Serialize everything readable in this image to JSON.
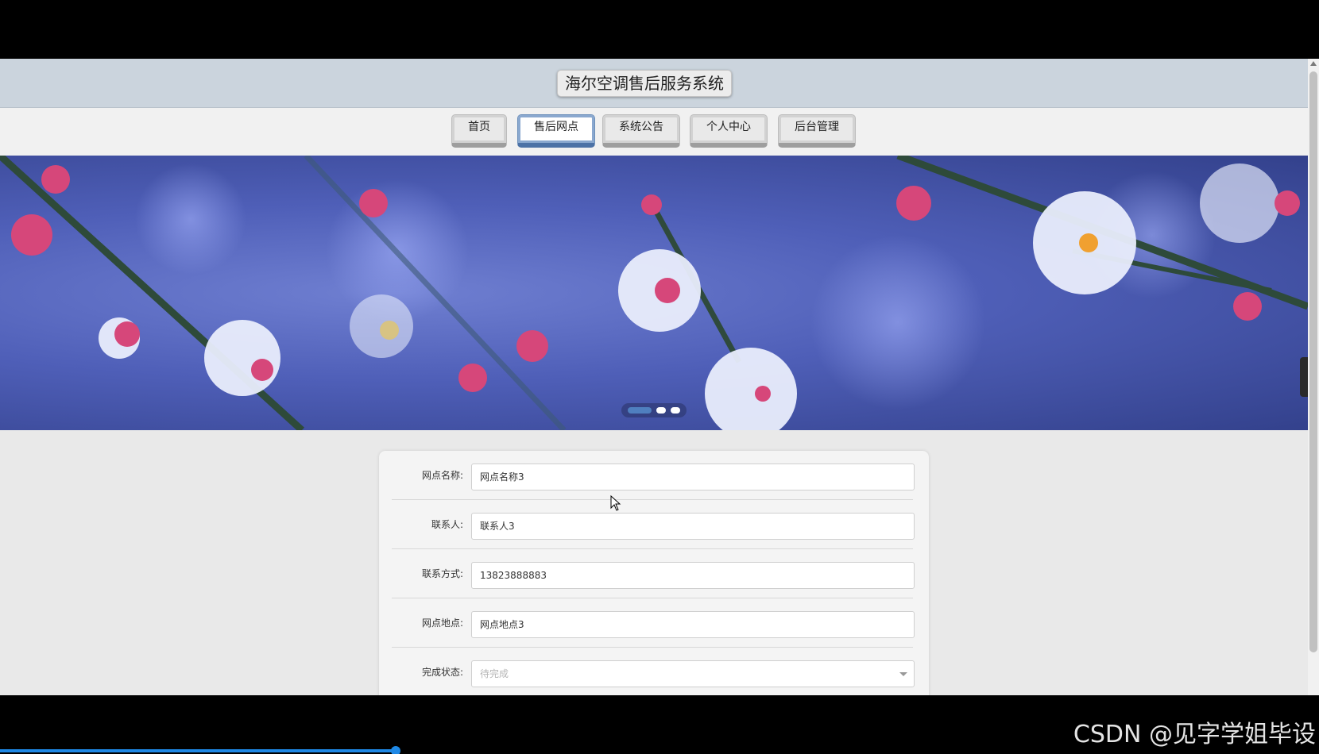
{
  "app": {
    "title": "海尔空调售后服务系统"
  },
  "nav": {
    "items": [
      {
        "label": "首页"
      },
      {
        "label": "售后网点"
      },
      {
        "label": "系统公告"
      },
      {
        "label": "个人中心"
      },
      {
        "label": "后台管理"
      }
    ],
    "active_index": 1
  },
  "banner": {
    "slide_count": 3,
    "active_slide": 1
  },
  "form": {
    "fields": [
      {
        "label": "网点名称:",
        "value": "网点名称3"
      },
      {
        "label": "联系人:",
        "value": "联系人3"
      },
      {
        "label": "联系方式:",
        "value": "13823888883"
      },
      {
        "label": "网点地点:",
        "value": "网点地点3"
      }
    ],
    "status": {
      "label": "完成状态:",
      "placeholder": "待完成"
    }
  },
  "icons": {
    "next_slide": "chevron-right-icon",
    "cursor": "mouse-cursor-icon"
  },
  "video": {
    "watermark": "CSDN @见字学姐毕设",
    "progress": 0.3
  },
  "colors": {
    "title_bar": "#cbd4dd",
    "active_nav": "#4c72a6",
    "progress": "#1e88e5"
  }
}
